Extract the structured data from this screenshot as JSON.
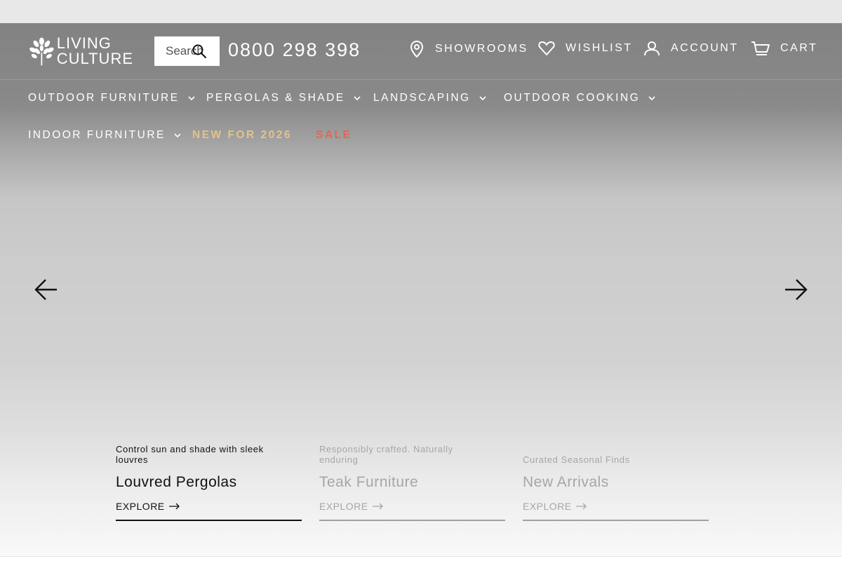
{
  "brand": {
    "line1": "LIVING",
    "line2": "CULTURE"
  },
  "search": {
    "placeholder": "Search"
  },
  "phone": "0800 298 398",
  "utility": {
    "showrooms": "SHOWROOMS",
    "wishlist": "WISHLIST",
    "account": "ACCOUNT",
    "cart": "CART"
  },
  "nav": {
    "outdoor_furniture": "OUTDOOR FURNITURE",
    "pergolas_shade": "PERGOLAS & SHADE",
    "landscaping": "LANDSCAPING",
    "outdoor_cooking": "OUTDOOR COOKING",
    "indoor_furniture": "INDOOR FURNITURE",
    "new_for_2026": "NEW FOR 2026",
    "sale": "SALE"
  },
  "colors": {
    "new_accent": "#e3c38a",
    "sale_accent": "#e8644c"
  },
  "slides": [
    {
      "subtitle": "Control sun and shade with sleek louvres",
      "title": "Louvred Pergolas",
      "cta": "EXPLORE"
    },
    {
      "subtitle": "Responsibly crafted. Naturally enduring",
      "title": "Teak Furniture",
      "cta": "EXPLORE"
    },
    {
      "subtitle": "Curated Seasonal Finds",
      "title": "New Arrivals",
      "cta": "EXPLORE"
    }
  ]
}
